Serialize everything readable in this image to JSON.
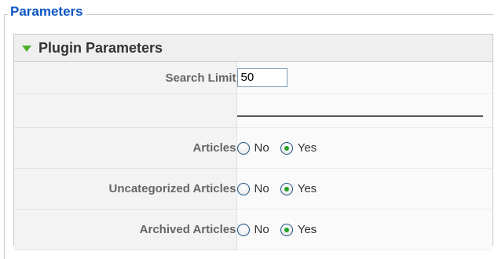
{
  "fieldset": {
    "legend": "Parameters"
  },
  "panel": {
    "title": "Plugin Parameters",
    "search_limit": {
      "label": "Search Limit",
      "value": "50"
    },
    "radio_options": {
      "no": "No",
      "yes": "Yes"
    },
    "rows": [
      {
        "label": "Articles",
        "selected": "Yes"
      },
      {
        "label": "Uncategorized Articles",
        "selected": "Yes"
      },
      {
        "label": "Archived Articles",
        "selected": "Yes"
      }
    ]
  },
  "colors": {
    "legend": "#0b55c4",
    "accent_arrow": "#4fae2b",
    "radio_dot": "#22a226"
  },
  "icons": {
    "collapse": "triangle-down-icon"
  }
}
